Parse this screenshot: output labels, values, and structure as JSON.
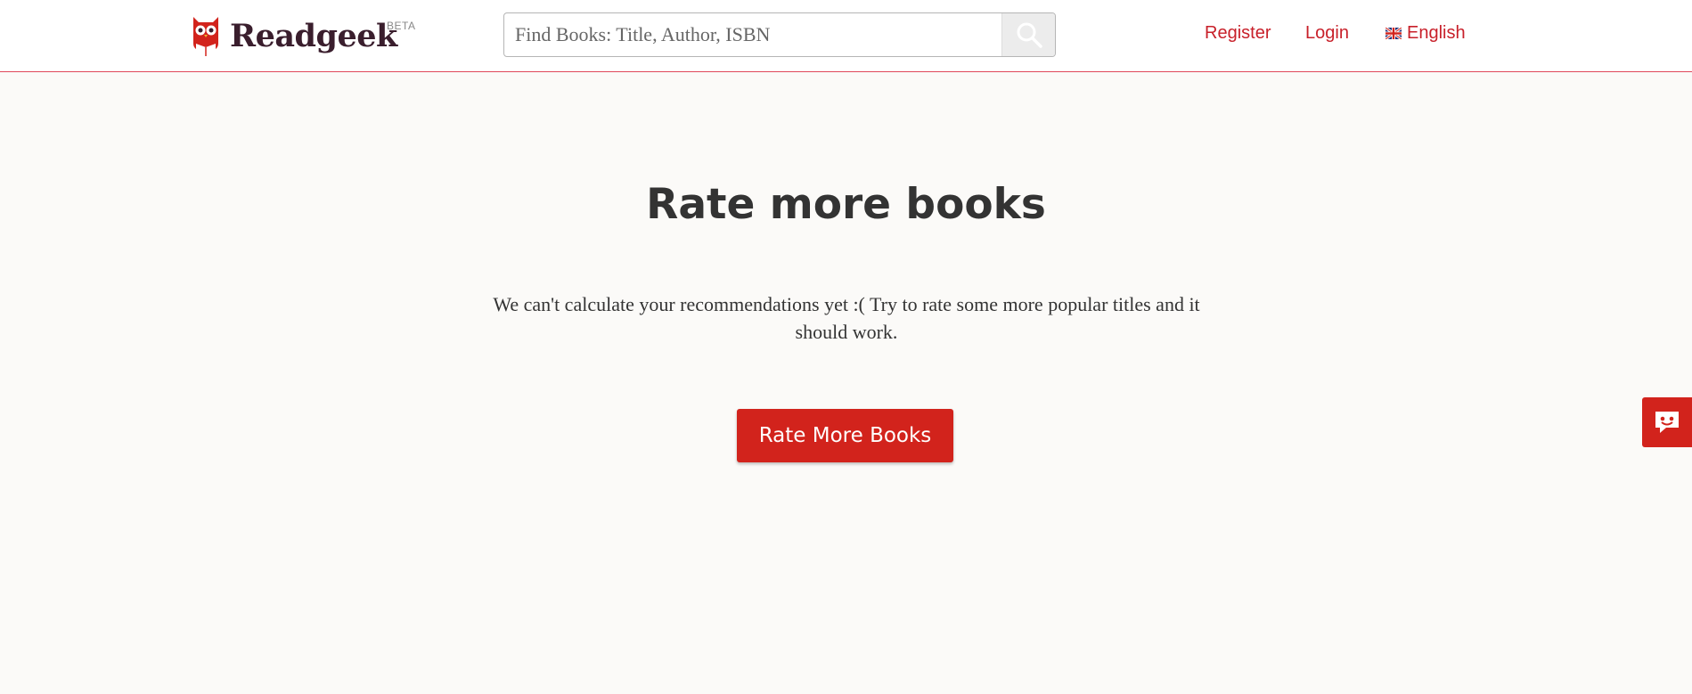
{
  "header": {
    "logo_text": "Readgeek",
    "logo_badge": "BETA",
    "search": {
      "placeholder": "Find Books: Title, Author, ISBN",
      "value": ""
    },
    "nav": {
      "register": "Register",
      "login": "Login",
      "language": "English"
    }
  },
  "main": {
    "title": "Rate more books",
    "description": "We can't calculate your recommendations yet :( Try to rate some more popular titles and it should work.",
    "cta_label": "Rate More Books"
  },
  "icons": {
    "logo": "owl-logo-icon",
    "search": "search-icon",
    "flag": "uk-flag-icon",
    "feedback": "chat-feedback-icon"
  },
  "colors": {
    "brand_red": "#d2231c",
    "link_red": "#c8202a",
    "logo_text": "#3a1e2d",
    "page_bg": "#fbfaf8",
    "heading": "#333333"
  }
}
